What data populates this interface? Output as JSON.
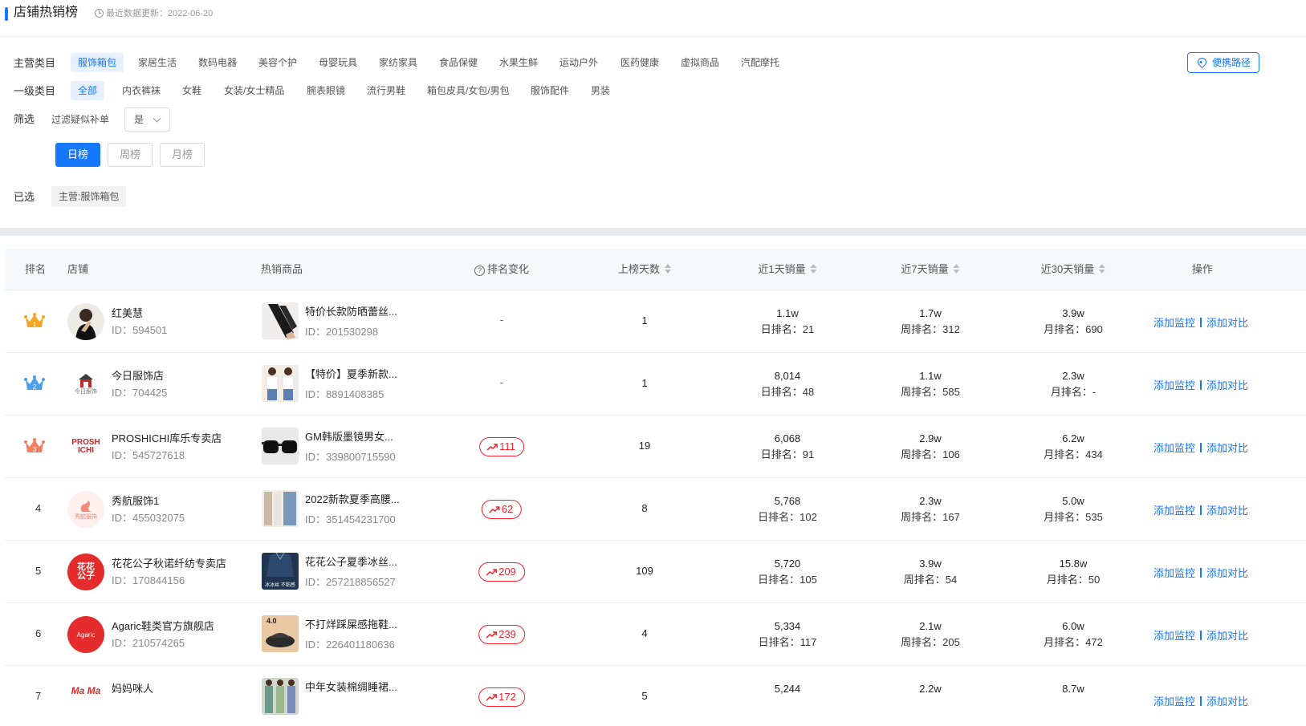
{
  "header": {
    "title": "店铺热销榜",
    "update_text": "最近数据更新：2022-06-20"
  },
  "main_category": {
    "label": "主营类目",
    "items": [
      "服饰箱包",
      "家居生活",
      "数码电器",
      "美容个护",
      "母婴玩具",
      "家纺家具",
      "食品保健",
      "水果生鲜",
      "运动户外",
      "医药健康",
      "虚拟商品",
      "汽配摩托"
    ],
    "active": "服饰箱包"
  },
  "shortcut_button": "便携路径",
  "sub_category": {
    "label": "一级类目",
    "items": [
      "全部",
      "内衣裤袜",
      "女鞋",
      "女装/女士精品",
      "腕表眼镜",
      "流行男鞋",
      "箱包皮具/女包/男包",
      "服饰配件",
      "男装"
    ],
    "active": "全部"
  },
  "filter": {
    "label": "筛选",
    "name": "过滤疑似补单",
    "value": "是"
  },
  "period": {
    "items": [
      "日榜",
      "周榜",
      "月榜"
    ],
    "active": "日榜"
  },
  "selected": {
    "label": "已选",
    "tag": "主营:服饰箱包"
  },
  "table": {
    "headers": {
      "rank": "排名",
      "shop": "店铺",
      "product": "热销商品",
      "rank_change": "排名变化",
      "days": "上榜天数",
      "sales_1d": "近1天销量",
      "sales_7d": "近7天销量",
      "sales_30d": "近30天销量",
      "ops": "操作"
    },
    "op_monitor": "添加监控",
    "op_compare": "添加对比",
    "rows": [
      {
        "rank": "1",
        "shop": "红美慧",
        "shop_id": "ID：594501",
        "product": "特价长款防晒蕾丝...",
        "product_id": "ID：201530298",
        "change": "-",
        "days": "1",
        "s1": "1.1w",
        "r1": "日排名：21",
        "s7": "1.7w",
        "r7": "周排名：312",
        "s30": "3.9w",
        "r30": "月排名：690"
      },
      {
        "rank": "2",
        "shop": "今日服饰店",
        "shop_id": "ID：704425",
        "product": "【特价】夏季新款...",
        "product_id": "ID：8891408385",
        "change": "-",
        "days": "1",
        "s1": "8,014",
        "r1": "日排名：48",
        "s7": "1.1w",
        "r7": "周排名：585",
        "s30": "2.3w",
        "r30": "月排名：-"
      },
      {
        "rank": "3",
        "shop": "PROSHICHI库乐专卖店",
        "shop_id": "ID：545727618",
        "product": "GM韩版墨镜男女...",
        "product_id": "ID：339800715590",
        "change": "111",
        "days": "19",
        "s1": "6,068",
        "r1": "日排名：91",
        "s7": "2.9w",
        "r7": "周排名：106",
        "s30": "6.2w",
        "r30": "月排名：434"
      },
      {
        "rank": "4",
        "shop": "秀航服饰1",
        "shop_id": "ID：455032075",
        "product": "2022新款夏季高腰...",
        "product_id": "ID：351454231700",
        "change": "62",
        "days": "8",
        "s1": "5,768",
        "r1": "日排名：102",
        "s7": "2.3w",
        "r7": "周排名：167",
        "s30": "5.0w",
        "r30": "月排名：535"
      },
      {
        "rank": "5",
        "shop": "花花公子秋诺纤纺专卖店",
        "shop_id": "ID：170844156",
        "product": "花花公子夏季冰丝...",
        "product_id": "ID：257218856527",
        "change": "209",
        "days": "109",
        "s1": "5,720",
        "r1": "日排名：105",
        "s7": "3.9w",
        "r7": "周排名：54",
        "s30": "15.8w",
        "r30": "月排名：50"
      },
      {
        "rank": "6",
        "shop": "Agaric鞋类官方旗舰店",
        "shop_id": "ID：210574265",
        "product": "不打烊踩屎感拖鞋...",
        "product_id": "ID：226401180636",
        "change": "239",
        "days": "4",
        "s1": "5,334",
        "r1": "日排名：117",
        "s7": "2.1w",
        "r7": "周排名：205",
        "s30": "6.0w",
        "r30": "月排名：472"
      },
      {
        "rank": "7",
        "shop": "妈妈咪人",
        "shop_id": "",
        "product": "中年女装棉绸睡裙...",
        "product_id": "",
        "change": "172",
        "days": "5",
        "s1": "5,244",
        "r1": "",
        "s7": "2.2w",
        "r7": "",
        "s30": "8.7w",
        "r30": ""
      }
    ]
  },
  "logos": {
    "r2": "今日服饰",
    "r3a": "PROSH",
    "r3b": "ICHI",
    "r4": "秀航服饰",
    "r5a": "花花",
    "r5b": "公子",
    "r6": "Agaric",
    "r7": "Ma Ma"
  },
  "thumbs": {
    "r5": "冰冰丝 不粘感",
    "r6": "4.0"
  },
  "colors": {
    "primary": "#1677ff",
    "up_red": "#f5222d",
    "gold": "#f5a623",
    "silver": "#4a9eea",
    "bronze": "#f07f5f"
  }
}
